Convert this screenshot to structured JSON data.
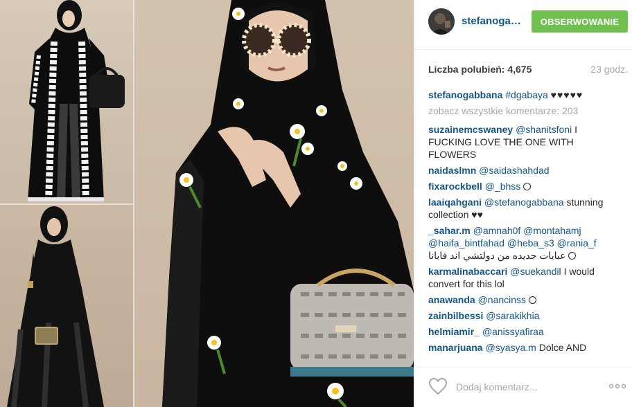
{
  "header": {
    "username": "stefanogabbana",
    "follow_label": "OBSERWOWANIE"
  },
  "likes": {
    "label": "Liczba polubień:",
    "count": "4,675",
    "time": "23 godz."
  },
  "caption": {
    "user": "stefanogabbana",
    "hashtag": "#dgabaya",
    "hearts": "♥♥♥♥♥"
  },
  "view_all_comments": "zobacz wszystkie komentarze: 203",
  "comments": [
    {
      "user": "suzainemcswaney",
      "mention": "@shanitsfoni",
      "text": "I FUCKING LOVE THE ONE WITH FLOWERS"
    },
    {
      "user": "naidaslmn",
      "mention": "@saidashahdad",
      "text": ""
    },
    {
      "user": "fixarockbell",
      "mention": "@_bhss",
      "text": ""
    },
    {
      "user": "laaiqahgani",
      "mention": "@stefanogabbana",
      "text": "stunning collection ♥♥"
    },
    {
      "user": "_sahar.m",
      "mention": "@amnah0f @montahamj @haifa_bintfahad @heba_s3 @rania_f",
      "text": "عبايات جديده من دولتشي اند قابانا"
    },
    {
      "user": "karmalinabaccari",
      "mention": "@suekandil",
      "text": "I would convert for this lol"
    },
    {
      "user": "anawanda",
      "mention": "@nancinss",
      "text": ""
    },
    {
      "user": "zainbilbessi",
      "mention": "@sarakikhia",
      "text": ""
    },
    {
      "user": "helmiamir_",
      "mention": "@anissyafiraa",
      "text": ""
    },
    {
      "user": "manarjuana",
      "mention": "@syasya.m",
      "text": "Dolce AND"
    }
  ],
  "comment_box": {
    "placeholder": "Dodaj komentarz..."
  },
  "icons": {
    "like": "heart-outline-icon",
    "more": "ellipsis-icon"
  },
  "colors": {
    "follow_button": "#70c050",
    "username_link": "#125688",
    "muted_text": "#a5a7aa"
  }
}
